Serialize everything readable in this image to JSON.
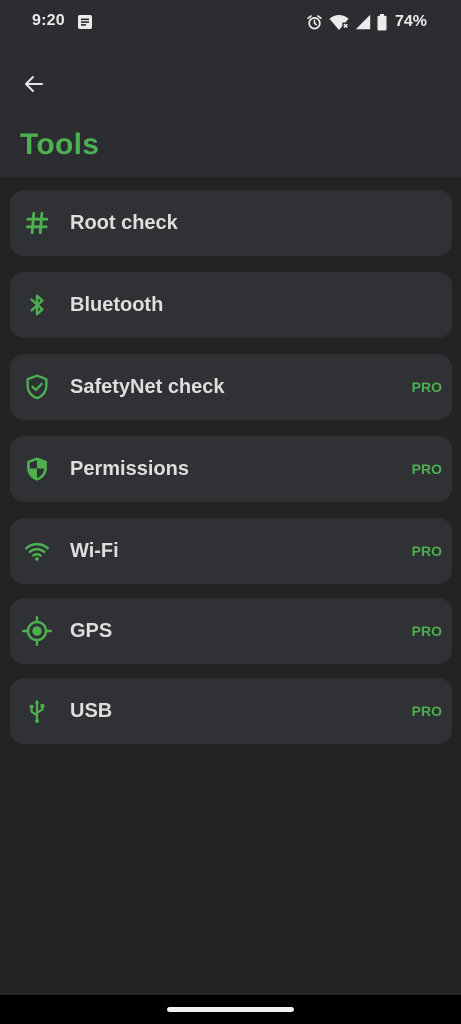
{
  "status_bar": {
    "time": "9:20",
    "battery": "74%"
  },
  "header": {
    "title": "Tools"
  },
  "items": [
    {
      "label": "Root check",
      "icon": "hash-icon",
      "pro": ""
    },
    {
      "label": "Bluetooth",
      "icon": "bluetooth-icon",
      "pro": ""
    },
    {
      "label": "SafetyNet check",
      "icon": "shield-check-icon",
      "pro": "PRO"
    },
    {
      "label": "Permissions",
      "icon": "shield-half-icon",
      "pro": "PRO"
    },
    {
      "label": "Wi-Fi",
      "icon": "wifi-icon",
      "pro": "PRO"
    },
    {
      "label": "GPS",
      "icon": "gps-icon",
      "pro": "PRO"
    },
    {
      "label": "USB",
      "icon": "usb-icon",
      "pro": "PRO"
    }
  ],
  "colors": {
    "accent": "#4caf50",
    "background": "#232323",
    "header": "#2c2d30",
    "card": "#303134"
  }
}
